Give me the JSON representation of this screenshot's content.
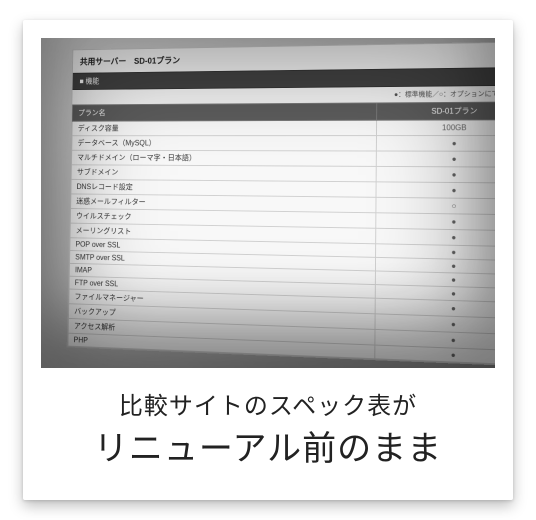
{
  "title": "共用サーバー　SD-01プラン",
  "section": "■ 機能",
  "legend": "●：標準機能／○：オプションにて利用可能",
  "header_name": "プラン名",
  "header_value": "SD-01プラン",
  "rows": [
    {
      "label": "ディスク容量",
      "value": "100GB"
    },
    {
      "label": "データベース（MySQL）",
      "value": "●"
    },
    {
      "label": "マルチドメイン（ローマ字・日本語）",
      "value": "●"
    },
    {
      "label": "サブドメイン",
      "value": "●"
    },
    {
      "label": "DNSレコード設定",
      "value": "●"
    },
    {
      "label": "迷惑メールフィルター",
      "value": "○"
    },
    {
      "label": "ウイルスチェック",
      "value": "●"
    },
    {
      "label": "メーリングリスト",
      "value": "●"
    },
    {
      "label": "POP over SSL",
      "value": "●"
    },
    {
      "label": "SMTP over SSL",
      "value": "●"
    },
    {
      "label": "IMAP",
      "value": "●"
    },
    {
      "label": "FTP over SSL",
      "value": "●"
    },
    {
      "label": "ファイルマネージャー",
      "value": "●"
    },
    {
      "label": "バックアップ",
      "value": "●"
    },
    {
      "label": "アクセス解析",
      "value": "●"
    },
    {
      "label": "PHP",
      "value": "●"
    }
  ],
  "caption_line1": "比較サイトのスペック表が",
  "caption_line2": "リニューアル前のまま"
}
